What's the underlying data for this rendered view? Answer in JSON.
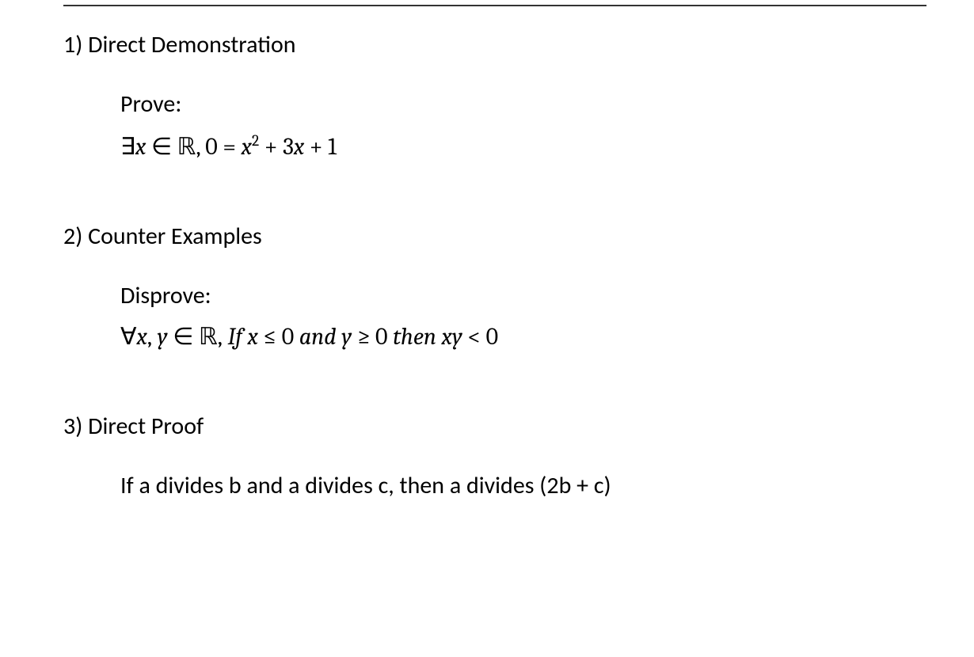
{
  "problems": {
    "p1": {
      "title": "1) Direct Demonstration",
      "instruction": "Prove:",
      "math_html": "<span class='upright'>∃</span>x <span class='upright'>∈ ℝ, 0 =</span> x<sup>2</sup> <span class='upright'>+ 3</span>x <span class='upright'>+ 1</span>"
    },
    "p2": {
      "title": "2) Counter Examples",
      "instruction": "Disprove:",
      "math_html": "<span class='upright'>∀</span>x<span class='upright'>,</span> y <span class='upright'>∈ ℝ,</span> If x <span class='upright'>≤ 0</span> and y <span class='upright'>≥ 0</span> then xy <span class='upright'>&lt; 0</span>"
    },
    "p3": {
      "title": "3) Direct Proof",
      "statement": "If a divides b and a divides c, then a divides (2b + c)"
    }
  }
}
